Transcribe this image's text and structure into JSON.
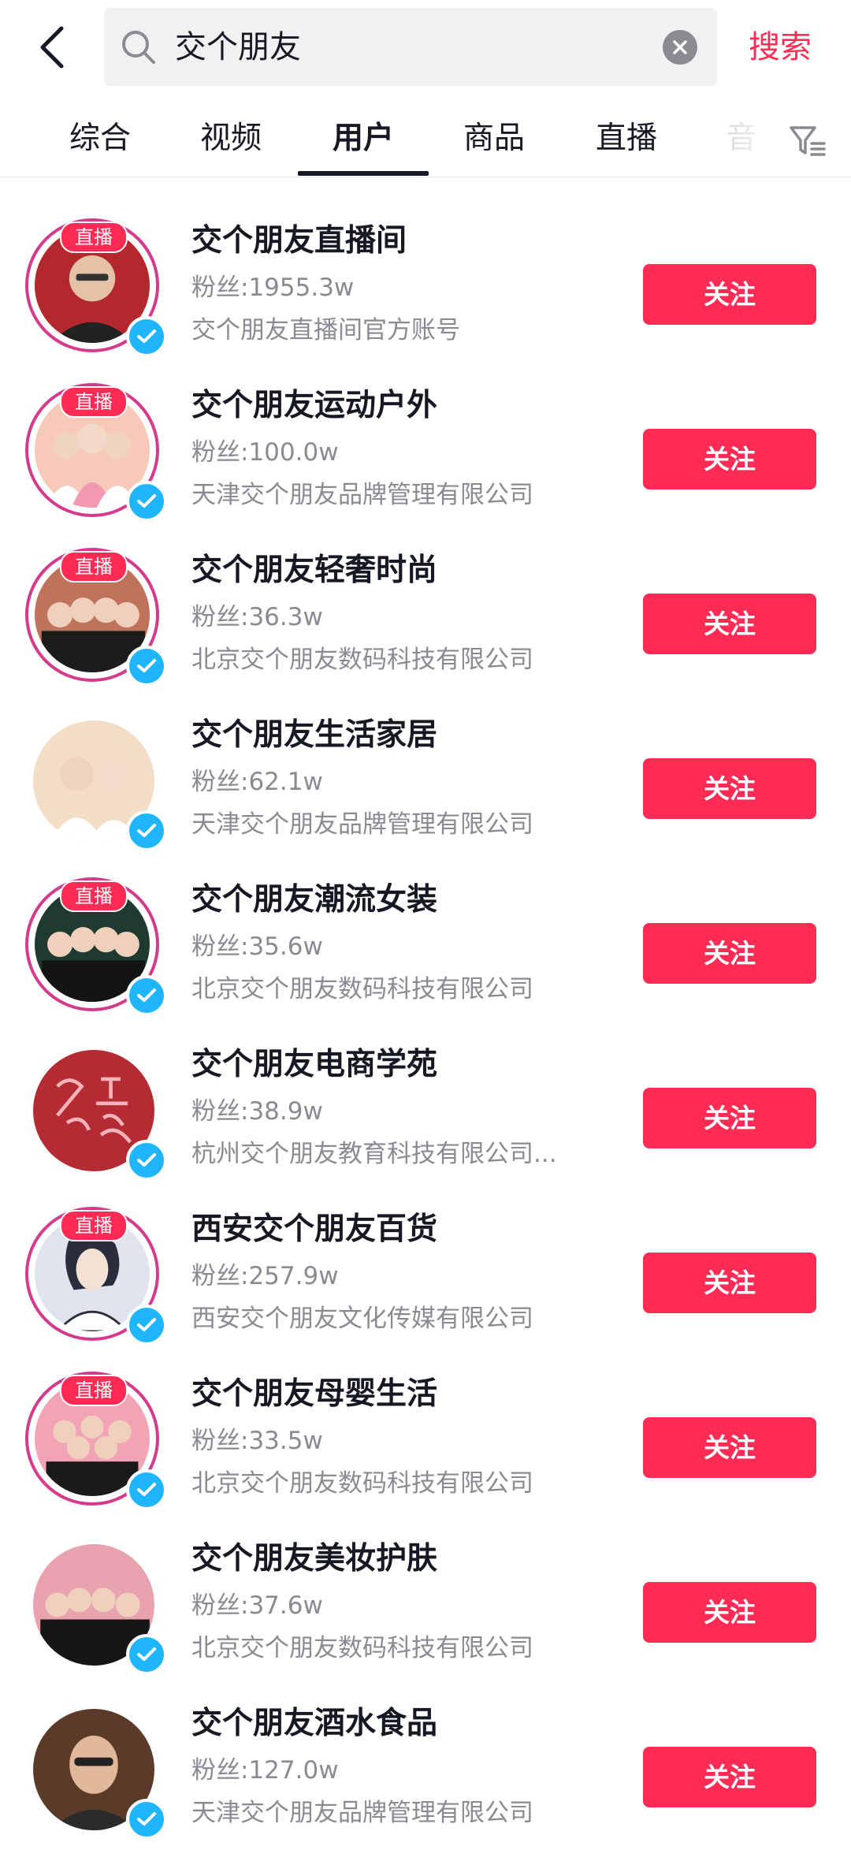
{
  "header": {
    "search_value": "交个朋友",
    "search_button": "搜索"
  },
  "tabs": [
    {
      "label": "综合"
    },
    {
      "label": "视频"
    },
    {
      "label": "用户"
    },
    {
      "label": "商品"
    },
    {
      "label": "直播"
    },
    {
      "label": "音"
    }
  ],
  "active_tab": "用户",
  "icons": {
    "back": "chevron-left-icon",
    "search": "search-icon",
    "clear": "clear-icon",
    "filter": "filter-icon",
    "verified": "verified-check-icon"
  },
  "colors": {
    "accent": "#fe2c55",
    "live_ring": "#d53b8c",
    "verified": "#20b5ff",
    "secondary_text": "#8a8b91"
  },
  "users": [
    {
      "name": "交个朋友直播间",
      "fans": "粉丝:1955.3w",
      "desc": "交个朋友直播间官方账号",
      "live": true,
      "live_label": "直播",
      "follow": "关注"
    },
    {
      "name": "交个朋友运动户外",
      "fans": "粉丝:100.0w",
      "desc": "天津交个朋友品牌管理有限公司",
      "live": true,
      "live_label": "直播",
      "follow": "关注"
    },
    {
      "name": "交个朋友轻奢时尚",
      "fans": "粉丝:36.3w",
      "desc": "北京交个朋友数码科技有限公司",
      "live": true,
      "live_label": "直播",
      "follow": "关注"
    },
    {
      "name": "交个朋友生活家居",
      "fans": "粉丝:62.1w",
      "desc": "天津交个朋友品牌管理有限公司",
      "live": false,
      "follow": "关注"
    },
    {
      "name": "交个朋友潮流女装",
      "fans": "粉丝:35.6w",
      "desc": "北京交个朋友数码科技有限公司",
      "live": true,
      "live_label": "直播",
      "follow": "关注"
    },
    {
      "name": "交个朋友电商学苑",
      "fans": "粉丝:38.9w",
      "desc": "杭州交个朋友教育科技有限公司...",
      "live": false,
      "follow": "关注"
    },
    {
      "name": "西安交个朋友百货",
      "fans": "粉丝:257.9w",
      "desc": "西安交个朋友文化传媒有限公司",
      "live": true,
      "live_label": "直播",
      "follow": "关注"
    },
    {
      "name": "交个朋友母婴生活",
      "fans": "粉丝:33.5w",
      "desc": "北京交个朋友数码科技有限公司",
      "live": true,
      "live_label": "直播",
      "follow": "关注"
    },
    {
      "name": "交个朋友美妆护肤",
      "fans": "粉丝:37.6w",
      "desc": "北京交个朋友数码科技有限公司",
      "live": false,
      "follow": "关注"
    },
    {
      "name": "交个朋友酒水食品",
      "fans": "粉丝:127.0w",
      "desc": "天津交个朋友品牌管理有限公司",
      "live": false,
      "follow": "关注"
    }
  ]
}
